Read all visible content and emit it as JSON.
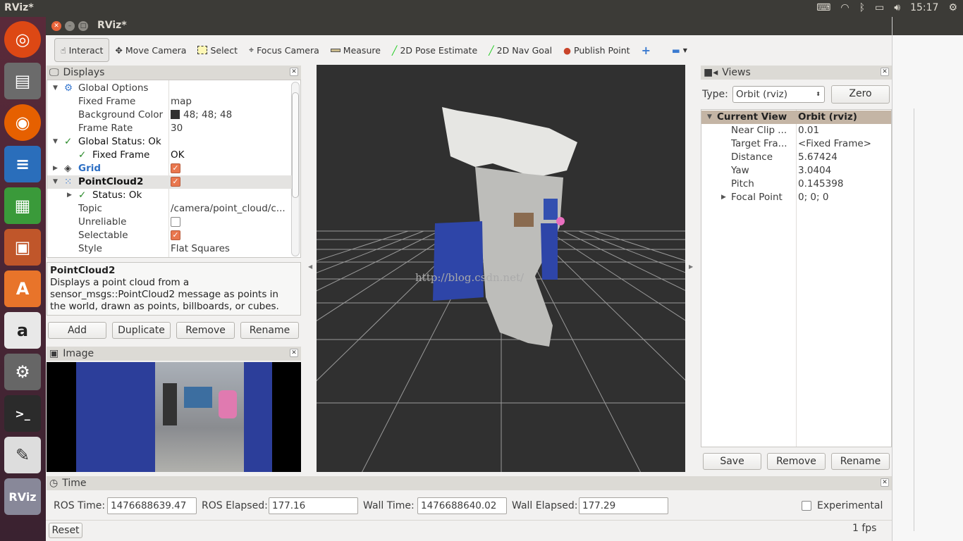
{
  "topbar": {
    "title": "RViz*",
    "time": "15:17",
    "icons": [
      "keyboard-icon",
      "wifi-icon",
      "bluetooth-icon",
      "battery-icon",
      "volume-icon",
      "power-icon"
    ]
  },
  "launcher": {
    "items": [
      "ubuntu-dash",
      "files",
      "firefox",
      "libreoffice-writer",
      "libreoffice-calc",
      "libreoffice-impress",
      "software-center",
      "amazon",
      "system-settings",
      "terminal",
      "text-editor",
      "rviz"
    ],
    "rviz_label": "RViz"
  },
  "window": {
    "title": "RViz*"
  },
  "toolbar": {
    "items": [
      {
        "label": "Interact",
        "icon": "hand-icon"
      },
      {
        "label": "Move Camera",
        "icon": "move-icon"
      },
      {
        "label": "Select",
        "icon": "select-icon"
      },
      {
        "label": "Focus Camera",
        "icon": "focus-icon"
      },
      {
        "label": "Measure",
        "icon": "ruler-icon"
      },
      {
        "label": "2D Pose Estimate",
        "icon": "green-arrow-icon"
      },
      {
        "label": "2D Nav Goal",
        "icon": "green-arrow-icon"
      },
      {
        "label": "Publish Point",
        "icon": "pin-icon"
      }
    ]
  },
  "displays": {
    "title": "Displays",
    "rows": [
      {
        "k": "Global Options",
        "v": ""
      },
      {
        "k": "Fixed Frame",
        "v": "map"
      },
      {
        "k": "Background Color",
        "v": "48; 48; 48"
      },
      {
        "k": "Frame Rate",
        "v": "30"
      },
      {
        "k": "Global Status: Ok",
        "v": ""
      },
      {
        "k": "Fixed Frame",
        "v": "OK"
      },
      {
        "k": "Grid",
        "v": ""
      },
      {
        "k": "PointCloud2",
        "v": ""
      },
      {
        "k": "Status: Ok",
        "v": ""
      },
      {
        "k": "Topic",
        "v": "/camera/point_cloud/c..."
      },
      {
        "k": "Unreliable",
        "v": ""
      },
      {
        "k": "Selectable",
        "v": ""
      },
      {
        "k": "Style",
        "v": "Flat Squares"
      }
    ],
    "desc_title": "PointCloud2",
    "desc_text": "Displays a point cloud from a sensor_msgs::PointCloud2 message as points in the world, drawn as points, billboards, or cubes.",
    "buttons": [
      "Add",
      "Duplicate",
      "Remove",
      "Rename"
    ]
  },
  "image_panel": {
    "title": "Image"
  },
  "viewport": {
    "watermark": "http://blog.csdn.net/",
    "background": "#303030"
  },
  "views": {
    "title": "Views",
    "type_label": "Type:",
    "type_value": "Orbit (rviz)",
    "zero": "Zero",
    "header": {
      "k": "Current View",
      "v": "Orbit (rviz)"
    },
    "rows": [
      {
        "k": "Near Clip ...",
        "v": "0.01"
      },
      {
        "k": "Target Fra...",
        "v": "<Fixed Frame>"
      },
      {
        "k": "Distance",
        "v": "5.67424"
      },
      {
        "k": "Yaw",
        "v": "3.0404"
      },
      {
        "k": "Pitch",
        "v": "0.145398"
      },
      {
        "k": "Focal Point",
        "v": "0; 0; 0"
      }
    ],
    "buttons": [
      "Save",
      "Remove",
      "Rename"
    ]
  },
  "time": {
    "title": "Time",
    "ros_time_label": "ROS Time:",
    "ros_time": "1476688639.47",
    "ros_elapsed_label": "ROS Elapsed:",
    "ros_elapsed": "177.16",
    "wall_time_label": "Wall Time:",
    "wall_time": "1476688640.02",
    "wall_elapsed_label": "Wall Elapsed:",
    "wall_elapsed": "177.29",
    "experimental": "Experimental",
    "reset": "Reset",
    "fps": "1 fps"
  }
}
